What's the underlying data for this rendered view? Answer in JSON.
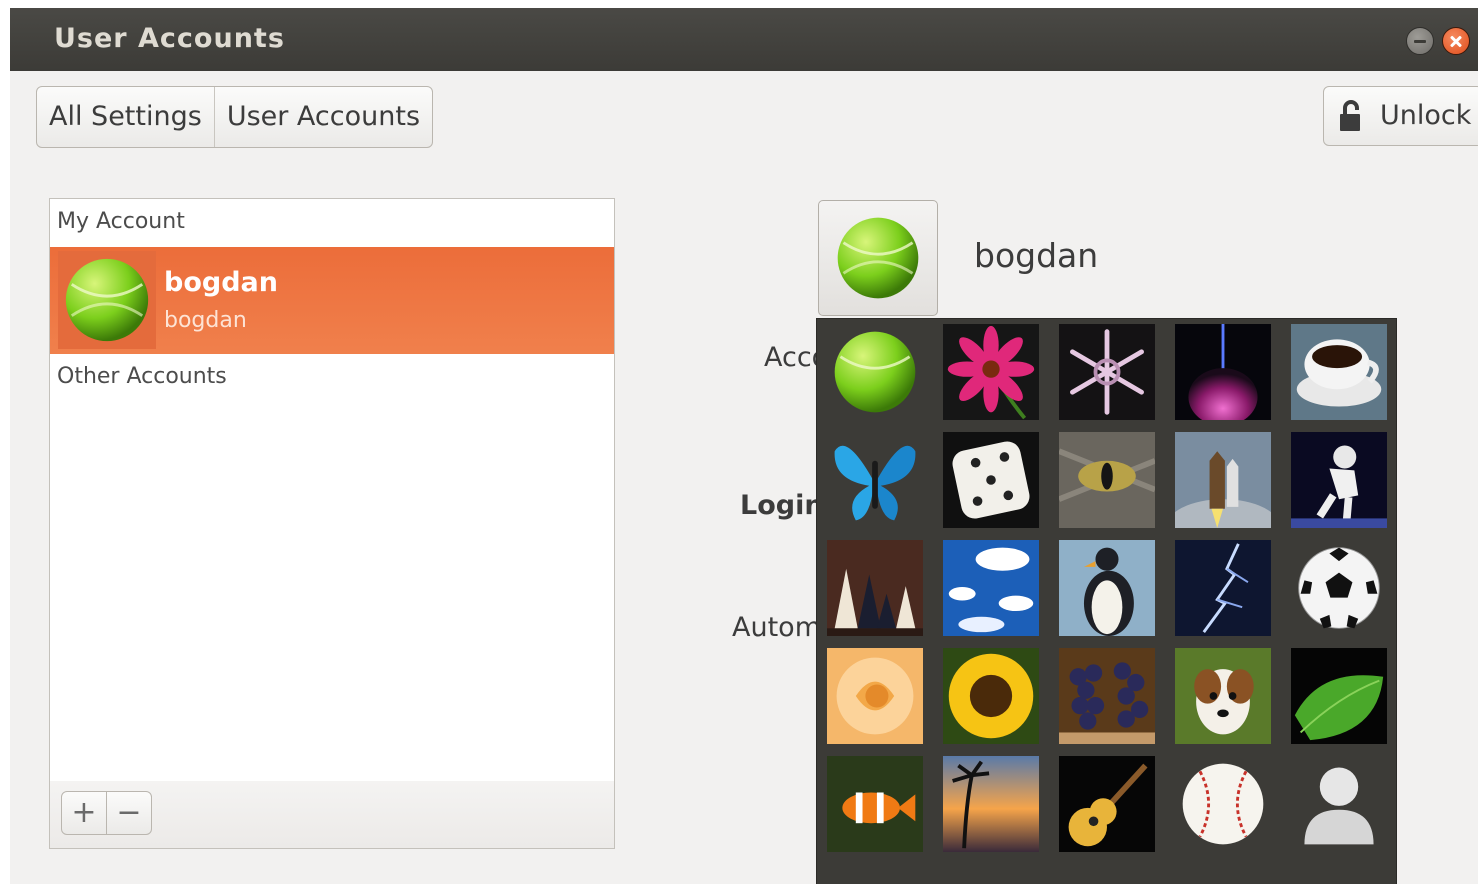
{
  "window": {
    "title": "User Accounts"
  },
  "breadcrumb": [
    "All Settings",
    "User Accounts"
  ],
  "unlock_label": "Unlock",
  "accounts": {
    "my_account_header": "My Account",
    "selected": {
      "name": "bogdan",
      "username": "bogdan"
    },
    "other_accounts_header": "Other Accounts",
    "add_label": "+",
    "remove_label": "−"
  },
  "details": {
    "user_name": "bogdan",
    "labels": {
      "account": "Acco",
      "login": "Login",
      "auto": "Autom"
    }
  },
  "avatar_picker": {
    "icons": [
      "tennis-ball",
      "flower",
      "snowflake",
      "plasma",
      "coffee",
      "butterfly",
      "dice",
      "cat-eye",
      "space-shuttle",
      "astronaut",
      "chess",
      "clouds",
      "penguin",
      "lightning",
      "soccer-ball",
      "rose",
      "sunflower",
      "grapes",
      "puppy",
      "leaf",
      "clownfish",
      "sunset",
      "guitar",
      "baseball",
      "default-user"
    ]
  },
  "colors": {
    "accent": "#ee7340",
    "titlebar": "#3c3b37",
    "picker_bg": "#3c3b37"
  }
}
